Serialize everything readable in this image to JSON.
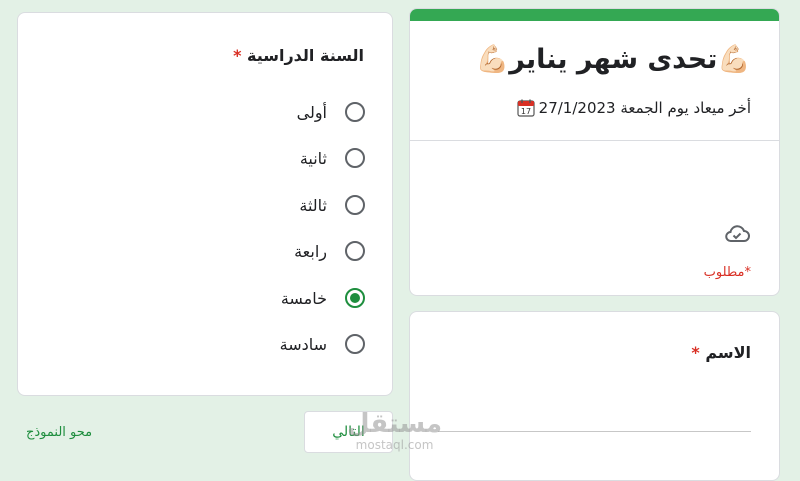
{
  "year_question": {
    "title": "السنة الدراسية",
    "required_mark": "*",
    "options": [
      {
        "label": "أولى",
        "selected": false
      },
      {
        "label": "ثانية",
        "selected": false
      },
      {
        "label": "ثالثة",
        "selected": false
      },
      {
        "label": "رابعة",
        "selected": false
      },
      {
        "label": "خامسة",
        "selected": true
      },
      {
        "label": "سادسة",
        "selected": false
      }
    ]
  },
  "actions": {
    "clear_label": "محو النموذج",
    "next_label": "التالي"
  },
  "header": {
    "title": "💪🏻تحدى شهر يناير💪🏻",
    "deadline_text": "أخر ميعاد يوم الجمعة  27/1/2023",
    "required_note": "*مطلوب"
  },
  "name_question": {
    "title": "الاسم",
    "required_mark": "*",
    "value": ""
  },
  "watermark": {
    "main": "مستقل",
    "sub": "mostaql.com"
  },
  "colors": {
    "accent": "#1e8e3e",
    "top_bar": "#34a853",
    "required": "#d93025",
    "background": "#e3f1e6"
  },
  "icons": [
    "calendar-icon",
    "cloud-check-icon"
  ]
}
